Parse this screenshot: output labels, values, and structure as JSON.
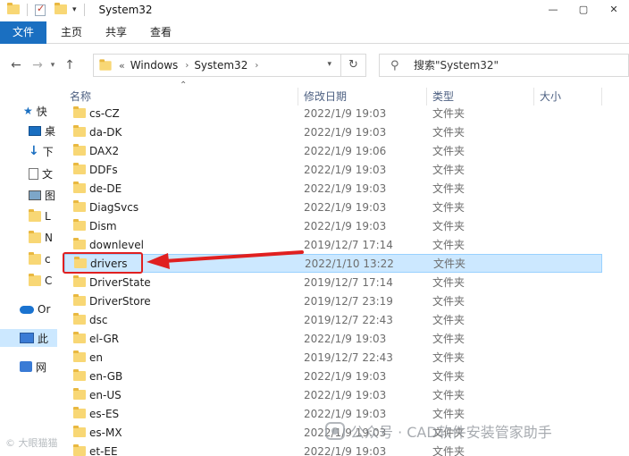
{
  "window": {
    "title": "System32",
    "controls": [
      "—",
      "▢",
      "✕"
    ]
  },
  "ribbon": {
    "file_tab": "文件",
    "tabs": [
      "主页",
      "共享",
      "查看"
    ]
  },
  "address": {
    "overflow": "«",
    "crumbs": [
      "Windows",
      "System32"
    ]
  },
  "search": {
    "placeholder": "搜索\"System32\""
  },
  "sidebar": {
    "items": [
      {
        "icon": "star-icon",
        "label": "快"
      },
      {
        "icon": "desktop-icon",
        "label": "桌"
      },
      {
        "icon": "download-icon",
        "label": "下"
      },
      {
        "icon": "document-icon",
        "label": "文"
      },
      {
        "icon": "picture-icon",
        "label": "图"
      },
      {
        "icon": "folder-icon",
        "label": "L"
      },
      {
        "icon": "folder-icon",
        "label": "N"
      },
      {
        "icon": "folder-icon",
        "label": "c"
      },
      {
        "icon": "folder-icon",
        "label": "C"
      },
      {
        "icon": "onedrive-icon",
        "label": "Or"
      },
      {
        "icon": "computer-icon",
        "label": "此"
      },
      {
        "icon": "network-icon",
        "label": "网"
      }
    ]
  },
  "columns": {
    "name": "名称",
    "date": "修改日期",
    "type": "类型",
    "size": "大小"
  },
  "files": [
    {
      "name": "cs-CZ",
      "date": "2022/1/9 19:03",
      "type": "文件夹"
    },
    {
      "name": "da-DK",
      "date": "2022/1/9 19:03",
      "type": "文件夹"
    },
    {
      "name": "DAX2",
      "date": "2022/1/9 19:06",
      "type": "文件夹"
    },
    {
      "name": "DDFs",
      "date": "2022/1/9 19:03",
      "type": "文件夹"
    },
    {
      "name": "de-DE",
      "date": "2022/1/9 19:03",
      "type": "文件夹"
    },
    {
      "name": "DiagSvcs",
      "date": "2022/1/9 19:03",
      "type": "文件夹"
    },
    {
      "name": "Dism",
      "date": "2022/1/9 19:03",
      "type": "文件夹"
    },
    {
      "name": "downlevel",
      "date": "2019/12/7 17:14",
      "type": "文件夹"
    },
    {
      "name": "drivers",
      "date": "2022/1/10 13:22",
      "type": "文件夹",
      "selected": true
    },
    {
      "name": "DriverState",
      "date": "2019/12/7 17:14",
      "type": "文件夹"
    },
    {
      "name": "DriverStore",
      "date": "2019/12/7 23:19",
      "type": "文件夹"
    },
    {
      "name": "dsc",
      "date": "2019/12/7 22:43",
      "type": "文件夹"
    },
    {
      "name": "el-GR",
      "date": "2022/1/9 19:03",
      "type": "文件夹"
    },
    {
      "name": "en",
      "date": "2019/12/7 22:43",
      "type": "文件夹"
    },
    {
      "name": "en-GB",
      "date": "2022/1/9 19:03",
      "type": "文件夹"
    },
    {
      "name": "en-US",
      "date": "2022/1/9 19:03",
      "type": "文件夹"
    },
    {
      "name": "es-ES",
      "date": "2022/1/9 19:03",
      "type": "文件夹"
    },
    {
      "name": "es-MX",
      "date": "2022/1/9 19:03",
      "type": "文件夹"
    },
    {
      "name": "et-EE",
      "date": "2022/1/9 19:03",
      "type": "文件夹"
    }
  ],
  "annotation": {
    "color": "#e02020"
  },
  "watermarks": {
    "left": "© 大眼猫猫",
    "right": "公众号 · CAD软件安装管家助手"
  },
  "colors": {
    "accent": "#1a6fc1",
    "selection": "#cce8ff",
    "folder": "#f8d775"
  }
}
